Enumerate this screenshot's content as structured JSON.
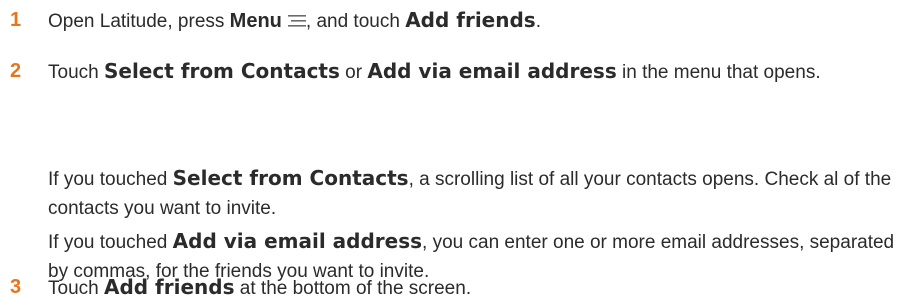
{
  "steps": [
    {
      "number": "1",
      "parts": [
        "Open Latitude, press ",
        "Menu",
        ", and touch ",
        "Add friends",
        "."
      ],
      "icon": "menu-icon"
    },
    {
      "number": "2",
      "parts": [
        "Touch ",
        "Select from Contacts",
        " or ",
        "Add via email address",
        " in the menu that opens."
      ],
      "followups": [
        {
          "parts": [
            "If you touched ",
            "Select from Contacts",
            ", a scrolling list of all your contacts opens. Check al of the contacts you want to invite."
          ]
        },
        {
          "parts": [
            "If you touched ",
            "Add via email address",
            ", you can enter one or more email addresses, separated by commas, for the friends you want to invite."
          ]
        }
      ]
    },
    {
      "number": "3",
      "parts": [
        "Touch ",
        "Add friends",
        " at the bottom of the screen."
      ]
    }
  ],
  "colors": {
    "step_number": "#e8751a",
    "text": "#2b2b2b"
  }
}
